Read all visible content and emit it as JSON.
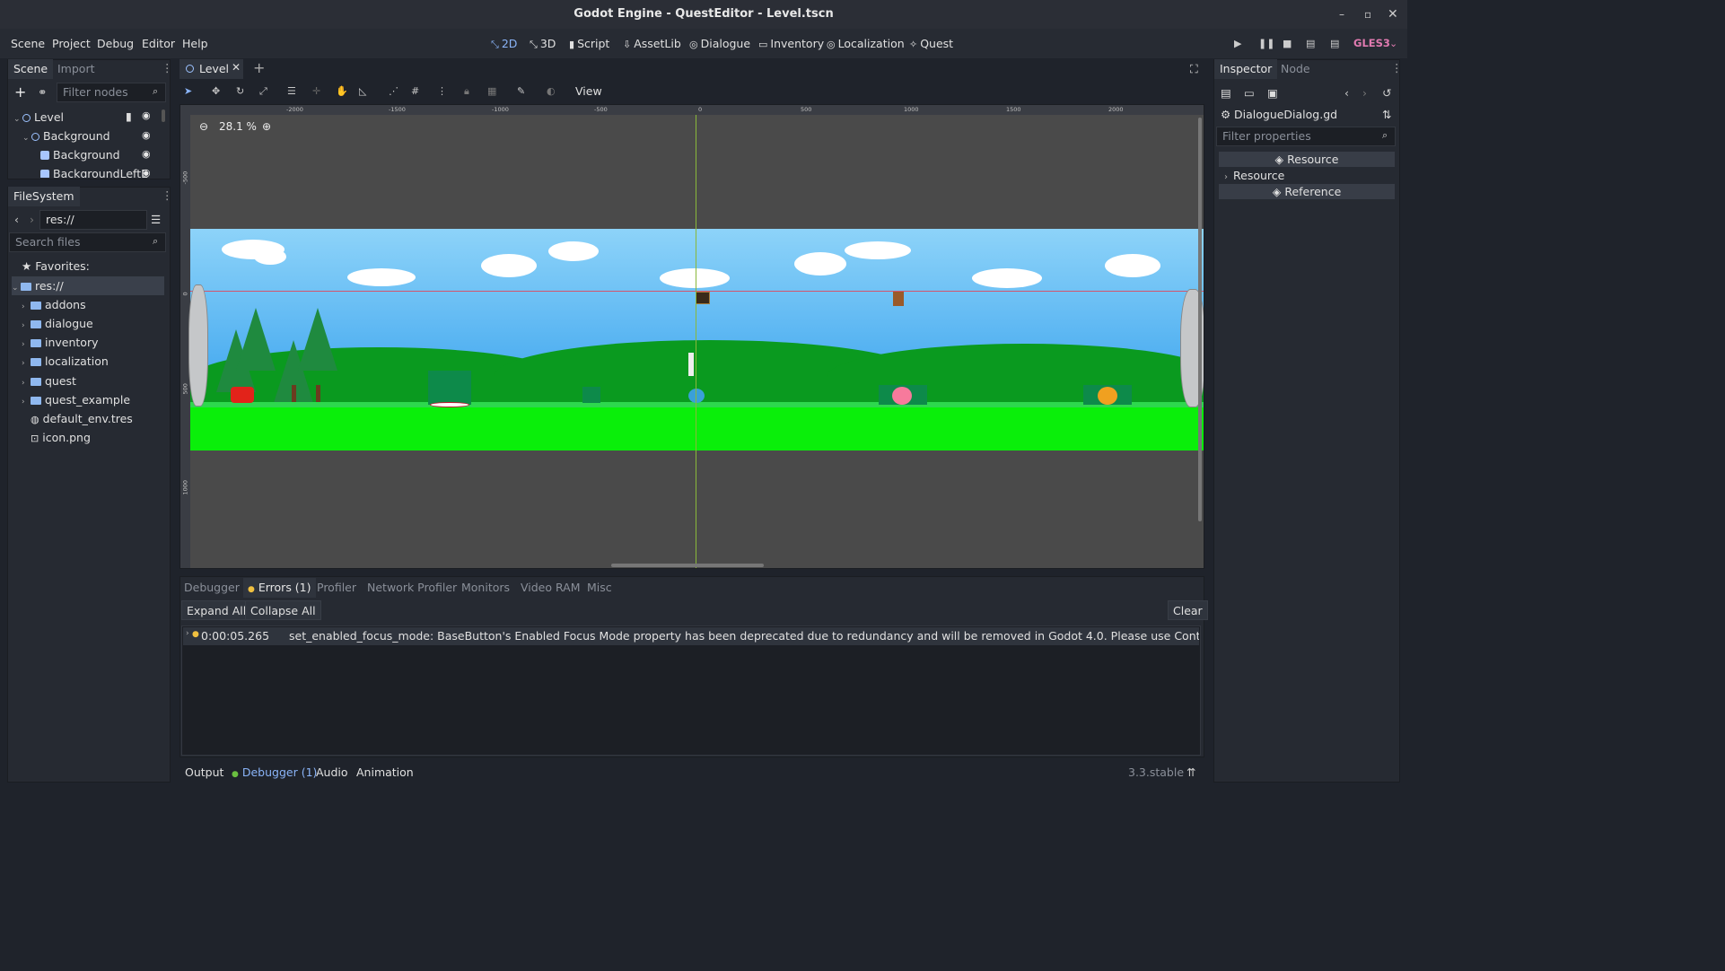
{
  "title": "Godot Engine - QuestEditor - Level.tscn",
  "menu": [
    "Scene",
    "Project",
    "Debug",
    "Editor",
    "Help"
  ],
  "workspaces": [
    {
      "label": "2D",
      "active": true
    },
    {
      "label": "3D"
    },
    {
      "label": "Script"
    },
    {
      "label": "AssetLib"
    },
    {
      "label": "Dialogue"
    },
    {
      "label": "Inventory"
    },
    {
      "label": "Localization"
    },
    {
      "label": "Quest"
    }
  ],
  "renderer": "GLES3",
  "scene_dock": {
    "tabs": [
      "Scene",
      "Import"
    ],
    "filter_placeholder": "Filter nodes",
    "nodes": [
      "Level",
      "Background",
      "Background",
      "BackgroundLeftE"
    ]
  },
  "filesystem": {
    "tab": "FileSystem",
    "path": "res://",
    "search_placeholder": "Search files",
    "favorites": "Favorites:",
    "root": "res://",
    "folders": [
      "addons",
      "dialogue",
      "inventory",
      "localization",
      "quest",
      "quest_example"
    ],
    "files": [
      "default_env.tres",
      "icon.png"
    ]
  },
  "editor_tab": "Level",
  "view_menu": "View",
  "zoom": "28.1 %",
  "ruler_h": [
    "-2000",
    "-1500",
    "-1000",
    "-500",
    "0",
    "500",
    "1000",
    "1500",
    "2000"
  ],
  "ruler_v": [
    "-500",
    "0",
    "500",
    "1000"
  ],
  "bottom": {
    "tabs": [
      "Debugger",
      "Errors (1)",
      "Profiler",
      "Network Profiler",
      "Monitors",
      "Video RAM",
      "Misc"
    ],
    "expand": "Expand All",
    "collapse": "Collapse All",
    "clear": "Clear",
    "error_time": "0:00:05.265",
    "error_msg": "set_enabled_focus_mode: BaseButton's Enabled Focus Mode property has been deprecated due to redundancy and will be removed in Godot 4.0. Please use Control.set_focus_mode inst"
  },
  "status": {
    "tabs": [
      "Output",
      "Debugger (1)",
      "Audio",
      "Animation"
    ],
    "version": "3.3.stable"
  },
  "inspector": {
    "tabs": [
      "Inspector",
      "Node"
    ],
    "script": "DialogueDialog.gd",
    "filter_placeholder": "Filter properties",
    "resource_header": "Resource",
    "resource_row": "Resource",
    "reference": "Reference"
  }
}
